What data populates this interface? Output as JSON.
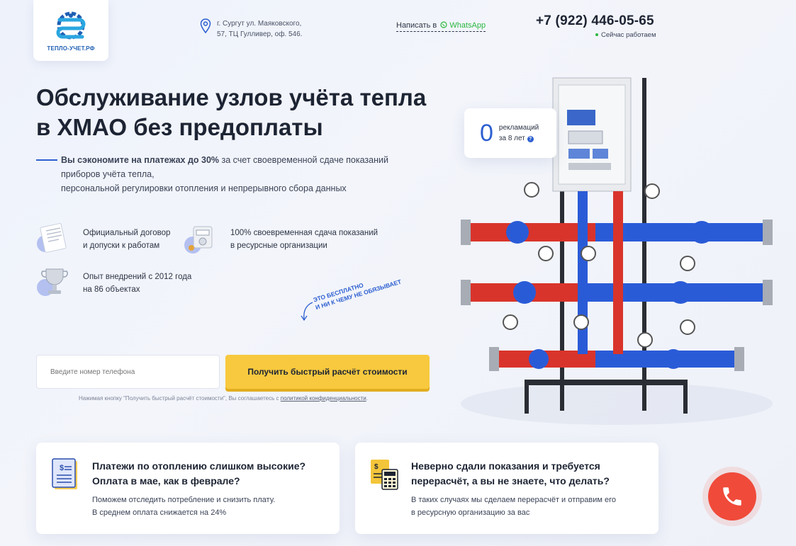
{
  "header": {
    "logo_text": "ТЕПЛО-УЧЕТ.РФ",
    "address": "г. Сургут ул. Маяковского, 57, ТЦ Гулливер, оф. 546.",
    "whatsapp_prefix": "Написать в",
    "whatsapp_label": "WhatsApp",
    "phone": "+7 (922) 446-05-65",
    "status": "Сейчас работаем",
    "colors": {
      "brand": "#2d5fd0",
      "whatsapp": "#2bb741",
      "status_dot": "#2bb741"
    }
  },
  "hero": {
    "title_line1": "Обслуживание узлов учёта тепла",
    "title_line2": "в ХМАО без предоплаты",
    "subtitle_bold": "Вы сэкономите на платежах до 30%",
    "subtitle_rest": " за счет своевременной сдаче показаний приборов учёта тепла,",
    "subtitle_line3": "персональной регулировки отопления и непрерывного сбора данных"
  },
  "features": [
    {
      "icon": "document-icon",
      "line1": "Официальный договор",
      "line2": "и допуски к работам"
    },
    {
      "icon": "meter-icon",
      "line1": "100% своевременная сдача показаний",
      "line2": "в ресурсные организации"
    },
    {
      "icon": "trophy-icon",
      "line1": "Опыт внедрений с 2012 года",
      "line2": "на 86 объектах"
    }
  ],
  "free_note": {
    "line1": "Это бесплатно",
    "line2": "и ни к чему не обязывает"
  },
  "form": {
    "phone_placeholder": "Введите номер телефона",
    "cta_label": "Получить быстрый расчёт стоимости",
    "cta_color": "#f8c93e",
    "consent_text": "Нажимая кнопку \"Получить быстрый расчёт стоимости\", Вы соглашаетесь с",
    "consent_link": "политикой конфиденциальности",
    "consent_end": "."
  },
  "rating": {
    "number": "0",
    "label_line1": "рекламаций",
    "label_line2": "за 8 лет",
    "help": "?"
  },
  "cards": [
    {
      "icon": "receipt-icon",
      "title_line1": "Платежи по отоплению слишком высокие?",
      "title_line2": "Оплата в мае, как в феврале?",
      "body_line1": "Поможем отследить потребление и снизить плату.",
      "body_line2": "В среднем оплата снижается на 24%"
    },
    {
      "icon": "calculator-icon",
      "title_line1": "Неверно сдали показания и требуется",
      "title_line2": "перерасчёт, а вы не знаете, что делать?",
      "body_line1": "В таких случаях мы сделаем перерасчёт и отправим его",
      "body_line2": "в ресурсную организацию за вас"
    }
  ],
  "call_button": {
    "icon": "phone-icon",
    "color": "#f04a3a"
  }
}
